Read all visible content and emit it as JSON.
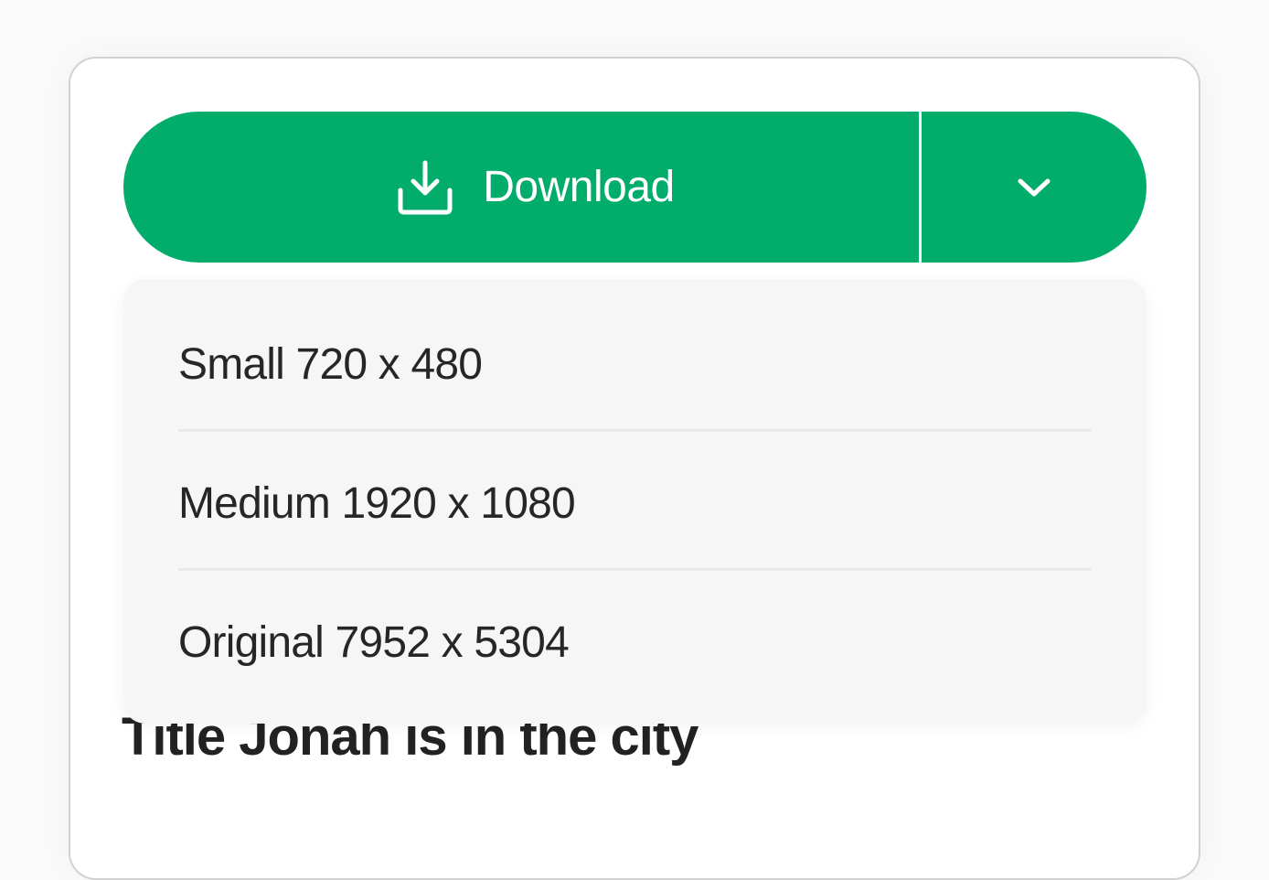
{
  "download_button": {
    "label": "Download",
    "icon": "download-icon",
    "toggle_icon": "chevron-down-icon",
    "color": "#02ac6b"
  },
  "menu": {
    "items": [
      {
        "label": "Small 720 x 480"
      },
      {
        "label": "Medium 1920 x 1080"
      },
      {
        "label": "Original 7952 x 5304"
      }
    ]
  },
  "content": {
    "title": "Title Jonah is in the city"
  }
}
